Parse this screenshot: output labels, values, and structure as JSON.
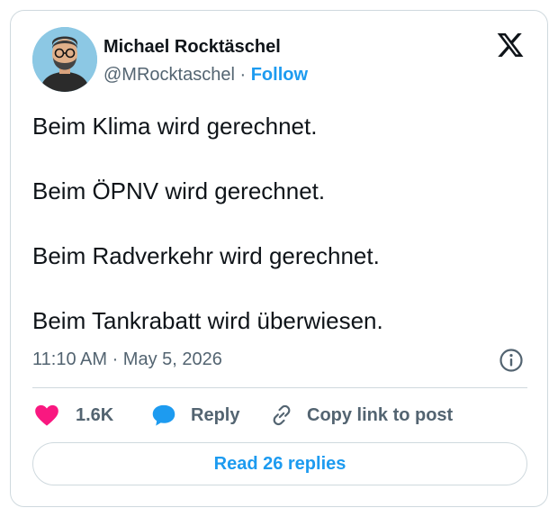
{
  "author": {
    "name": "Michael Rocktäschel",
    "handle": "@MRocktaschel",
    "separator": "·",
    "follow_label": "Follow"
  },
  "tweet": {
    "lines": [
      "Beim Klima wird gerechnet.",
      "Beim ÖPNV wird gerechnet.",
      "Beim Radverkehr wird gerechnet.",
      "Beim Tankrabatt wird überwiesen."
    ],
    "timestamp": "11:10 AM · May 5, 2026"
  },
  "actions": {
    "likes_count": "1.6K",
    "reply_label": "Reply",
    "copy_link_label": "Copy link to post"
  },
  "read_replies_label": "Read 26 replies",
  "icons": {
    "logo": "x-logo-icon",
    "info": "info-icon",
    "like": "heart-icon",
    "reply": "speech-bubble-icon",
    "copy": "link-icon"
  },
  "colors": {
    "accent": "#1d9bf0",
    "like": "#f91880",
    "text": "#0f1419",
    "secondary": "#536471",
    "border": "#cfd9de"
  }
}
